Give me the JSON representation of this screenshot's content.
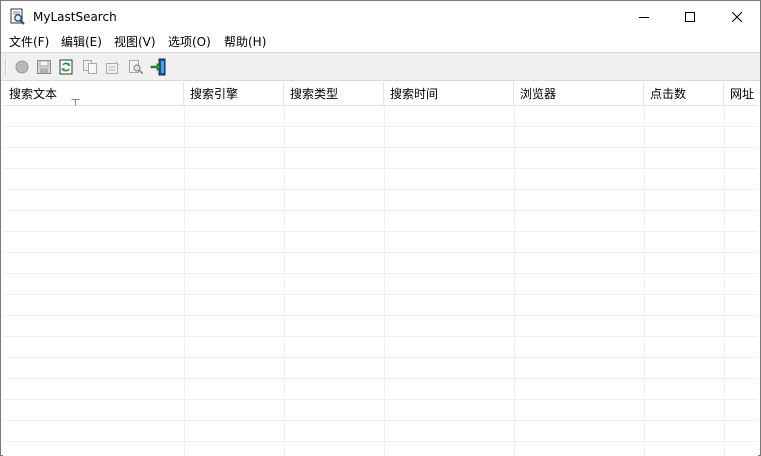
{
  "window": {
    "title": "MyLastSearch",
    "icon": "magnifier-document-icon",
    "controls": [
      "minimize",
      "maximize",
      "close"
    ]
  },
  "menu": {
    "file": "文件(F)",
    "edit": "编辑(E)",
    "view": "视图(V)",
    "options": "选项(O)",
    "help": "帮助(H)"
  },
  "toolbar": {
    "buttons": [
      "stop-icon",
      "save-icon",
      "refresh-icon",
      "copy-icon",
      "properties-icon",
      "find-icon",
      "exit-icon"
    ]
  },
  "list": {
    "columns": [
      "搜索文本",
      "搜索引擎",
      "搜索类型",
      "搜索时间",
      "浏览器",
      "点击数",
      "网址"
    ],
    "sort_indicator": "sort-ascending-icon",
    "rows": []
  }
}
